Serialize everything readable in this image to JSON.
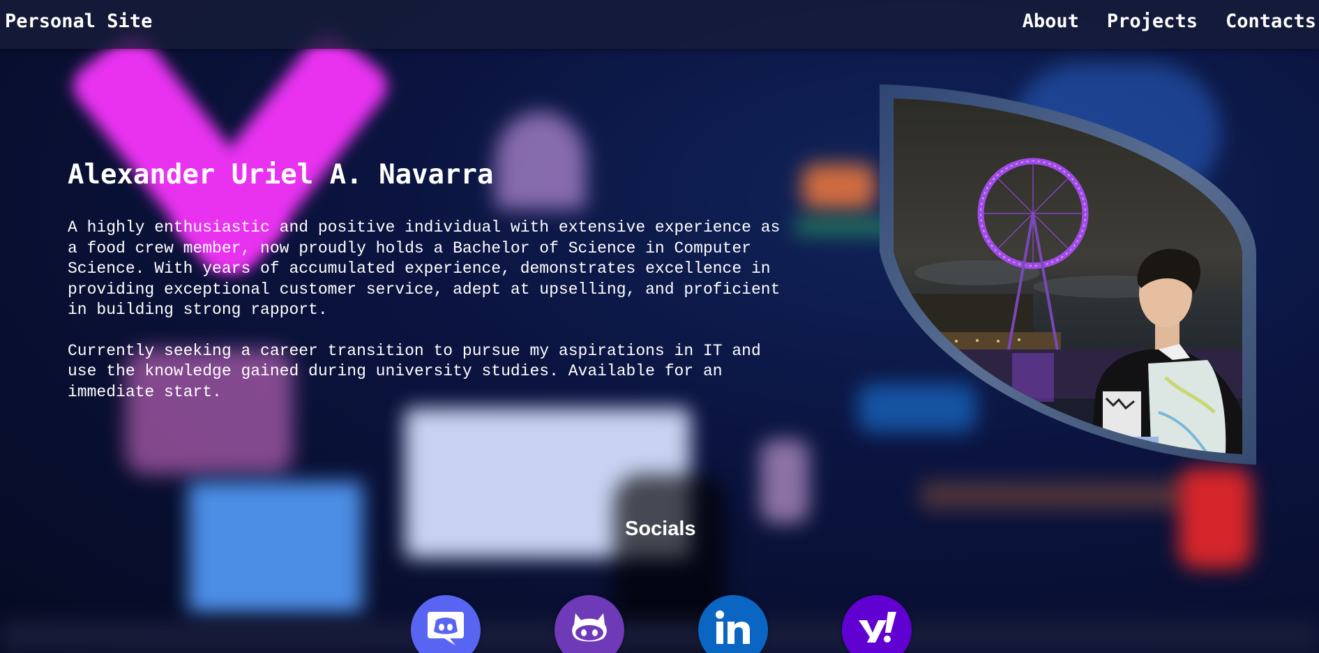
{
  "header": {
    "brand": "Personal Site",
    "nav": [
      {
        "label": "About"
      },
      {
        "label": "Projects"
      },
      {
        "label": "Contacts"
      }
    ]
  },
  "intro": {
    "name": "Alexander Uriel A. Navarra",
    "bio": [
      "A highly enthusiastic and positive individual with extensive experience as a food crew member, now proudly holds a Bachelor of Science in Computer Science. With years of accumulated experience, demonstrates excellence in providing exceptional customer service, adept at upselling, and proficient in building strong rapport.",
      "Currently seeking a career transition to pursue my aspirations in IT and use the knowledge gained during university studies. Available for an immediate start."
    ]
  },
  "photo": {
    "description_icon": "profile-photo-london-eye"
  },
  "socials": {
    "title": "Socials",
    "items": [
      {
        "icon": "discord-icon",
        "color": "#5865f2"
      },
      {
        "icon": "github-icon",
        "color": "#6e3ab8"
      },
      {
        "icon": "linkedin-icon",
        "color": "#0a66c2"
      },
      {
        "icon": "yahoo-icon",
        "color": "#6001d2"
      }
    ]
  },
  "colors": {
    "background": "#0a1030",
    "accent_magenta": "#e832f0",
    "frame": "#3c5a8c"
  }
}
